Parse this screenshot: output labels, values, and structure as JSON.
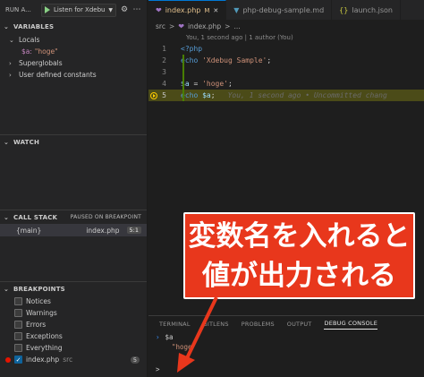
{
  "sidebar": {
    "run_title": "RUN A...",
    "config_label": "Listen for Xdebu",
    "variables": {
      "header": "VARIABLES",
      "locals_label": "Locals",
      "local_var_name": "$a:",
      "local_var_value": "\"hoge\"",
      "superglobals_label": "Superglobals",
      "user_constants_label": "User defined constants"
    },
    "watch": {
      "header": "WATCH"
    },
    "call_stack": {
      "header": "CALL STACK",
      "status": "PAUSED ON BREAKPOINT",
      "frame": "{main}",
      "file": "index.php",
      "position": "5:1"
    },
    "breakpoints": {
      "header": "BREAKPOINTS",
      "items": [
        {
          "label": "Notices",
          "checked": false
        },
        {
          "label": "Warnings",
          "checked": false
        },
        {
          "label": "Errors",
          "checked": false
        },
        {
          "label": "Exceptions",
          "checked": false
        },
        {
          "label": "Everything",
          "checked": false
        }
      ],
      "file_label": "index.php",
      "file_dir": "src",
      "file_line": "5"
    }
  },
  "editor": {
    "tabs": [
      {
        "label": "index.php",
        "modified": "M",
        "icon": "php-icon",
        "active": true
      },
      {
        "label": "php-debug-sample.md",
        "icon": "markdown-icon",
        "active": false
      },
      {
        "label": "launch.json",
        "icon": "json-icon",
        "active": false
      }
    ],
    "breadcrumb": {
      "folder": "src",
      "sep": ">",
      "file": "index.php",
      "tail": "..."
    },
    "blame_header": "You, 1 second ago | 1 author (You)",
    "lines": [
      {
        "n": "1",
        "text": "<?php"
      },
      {
        "n": "2",
        "kw": "echo",
        "str": "'Xdebug Sample'",
        "end": ";"
      },
      {
        "n": "3"
      },
      {
        "n": "4",
        "var": "$a",
        "op": " = ",
        "str": "'hoge'",
        "end": ";"
      },
      {
        "n": "5",
        "kw": "echo",
        "var": "$a",
        "end": ";",
        "blame": "You, 1 second ago • Uncommitted chang"
      }
    ]
  },
  "panel": {
    "tabs": [
      "TERMINAL",
      "GITLENS",
      "PROBLEMS",
      "OUTPUT",
      "DEBUG CONSOLE"
    ],
    "active_tab": "DEBUG CONSOLE",
    "console_input": "$a",
    "console_output": "\"hoge\"",
    "prompt_symbol": ">"
  },
  "annotation": {
    "line1": "変数名を入れると",
    "line2": "値が出力される",
    "color": "#e8371c"
  },
  "colors": {
    "accent": "#0078d4",
    "breakpoint": "#e51400",
    "current_line": "#4b4b18",
    "run": "#89d185"
  }
}
